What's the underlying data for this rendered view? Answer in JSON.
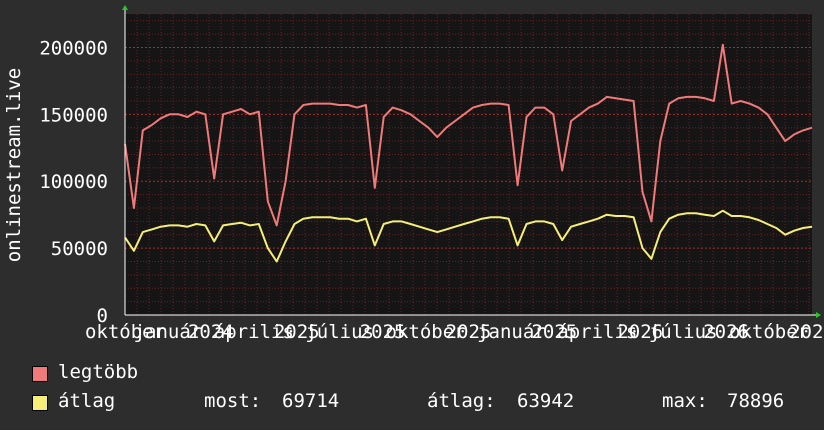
{
  "y_axis_label": "onlinestream.live",
  "chart_data": {
    "type": "line",
    "ylabel": "onlinestream.live",
    "ylim": [
      0,
      225000
    ],
    "y_ticks": [
      "0",
      "50000",
      "100000",
      "150000",
      "200000"
    ],
    "x_tick_labels": [
      "október",
      "január",
      "2024",
      "április",
      "2025",
      "július",
      "2025",
      "október",
      "2025",
      "január",
      "2025",
      "április",
      "2026",
      "július",
      "2026",
      "október",
      "2026"
    ],
    "grid": true,
    "colors": {
      "background": "#2d2d2d",
      "plot_bg": "#151515",
      "grid": "#6b2020",
      "axis": "#ffffff",
      "legtobb": "#f07a7a",
      "atlag": "#f5ef78"
    },
    "series": [
      {
        "name": "legtöbb",
        "values": [
          128000,
          80000,
          138000,
          142000,
          147000,
          150000,
          150000,
          148000,
          152000,
          150000,
          102000,
          150000,
          152000,
          154000,
          150000,
          152000,
          85000,
          67000,
          100000,
          150000,
          157000,
          158000,
          158000,
          158000,
          157000,
          157000,
          155000,
          157000,
          95000,
          148000,
          155000,
          153000,
          150000,
          145000,
          140000,
          133000,
          140000,
          145000,
          150000,
          155000,
          157000,
          158000,
          158000,
          157000,
          97000,
          148000,
          155000,
          155000,
          150000,
          108000,
          145000,
          150000,
          155000,
          158000,
          163000,
          162000,
          161000,
          160000,
          92000,
          70000,
          130000,
          158000,
          162000,
          163000,
          163000,
          162000,
          160000,
          202000,
          158000,
          160000,
          158000,
          155000,
          150000,
          140000,
          130000,
          135000,
          138000,
          140000
        ]
      },
      {
        "name": "átlag",
        "values": [
          58000,
          48000,
          62000,
          64000,
          66000,
          67000,
          67000,
          66000,
          68000,
          67000,
          55000,
          67000,
          68000,
          69000,
          67000,
          68000,
          50000,
          40000,
          55000,
          68000,
          72000,
          73000,
          73000,
          73000,
          72000,
          72000,
          70000,
          72000,
          52000,
          68000,
          70000,
          70000,
          68000,
          66000,
          64000,
          62000,
          64000,
          66000,
          68000,
          70000,
          72000,
          73000,
          73000,
          72000,
          52000,
          68000,
          70000,
          70000,
          68000,
          56000,
          66000,
          68000,
          70000,
          72000,
          75000,
          74000,
          74000,
          73000,
          50000,
          42000,
          62000,
          72000,
          75000,
          76000,
          76000,
          75000,
          74000,
          78000,
          74000,
          74000,
          73000,
          71000,
          68000,
          65000,
          60000,
          63000,
          65000,
          66000
        ]
      }
    ]
  },
  "legend": {
    "legtobb_label": "legtöbb",
    "atlag_label": "átlag",
    "most_label": "most:",
    "most_value": "69714",
    "atlag_stat_label": "átlag:",
    "atlag_stat_value": "63942",
    "max_label": "max:",
    "max_value": "78896"
  }
}
